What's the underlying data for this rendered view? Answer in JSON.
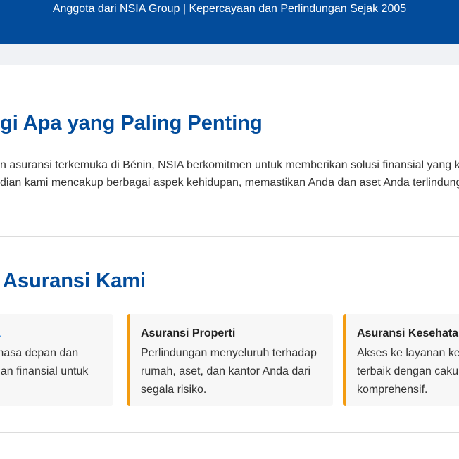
{
  "topbar": {
    "tagline": "Anggota dari NSIA Group | Kepercayaan dan Perlindungan Sejak 2005"
  },
  "hero": {
    "title": "gi Apa yang Paling Penting",
    "lines": [
      "n asuransi terkemuka di Bénin, NSIA berkomitmen untuk memberikan solusi finansial yang ko",
      "dian kami mencakup berbagai aspek kehidupan, memastikan Anda dan aset Anda terlindungi"
    ]
  },
  "services": {
    "title": "Asuransi Kami",
    "cards": [
      {
        "title": "a",
        "lines": [
          "masa depan dan",
          "nan finansial untuk"
        ]
      },
      {
        "title": "Asuransi Properti",
        "lines": [
          "Perlindungan menyeluruh terhadap",
          "rumah, aset, dan kantor Anda dari",
          "segala risiko."
        ]
      },
      {
        "title": "Asuransi Kesehata",
        "lines": [
          "Akses ke layanan ke",
          "terbaik dengan caku",
          "komprehensif."
        ]
      }
    ]
  },
  "colors": {
    "brand_blue": "#034c9b",
    "accent_orange": "#f39c12",
    "link_blue": "#3a8ee6"
  }
}
